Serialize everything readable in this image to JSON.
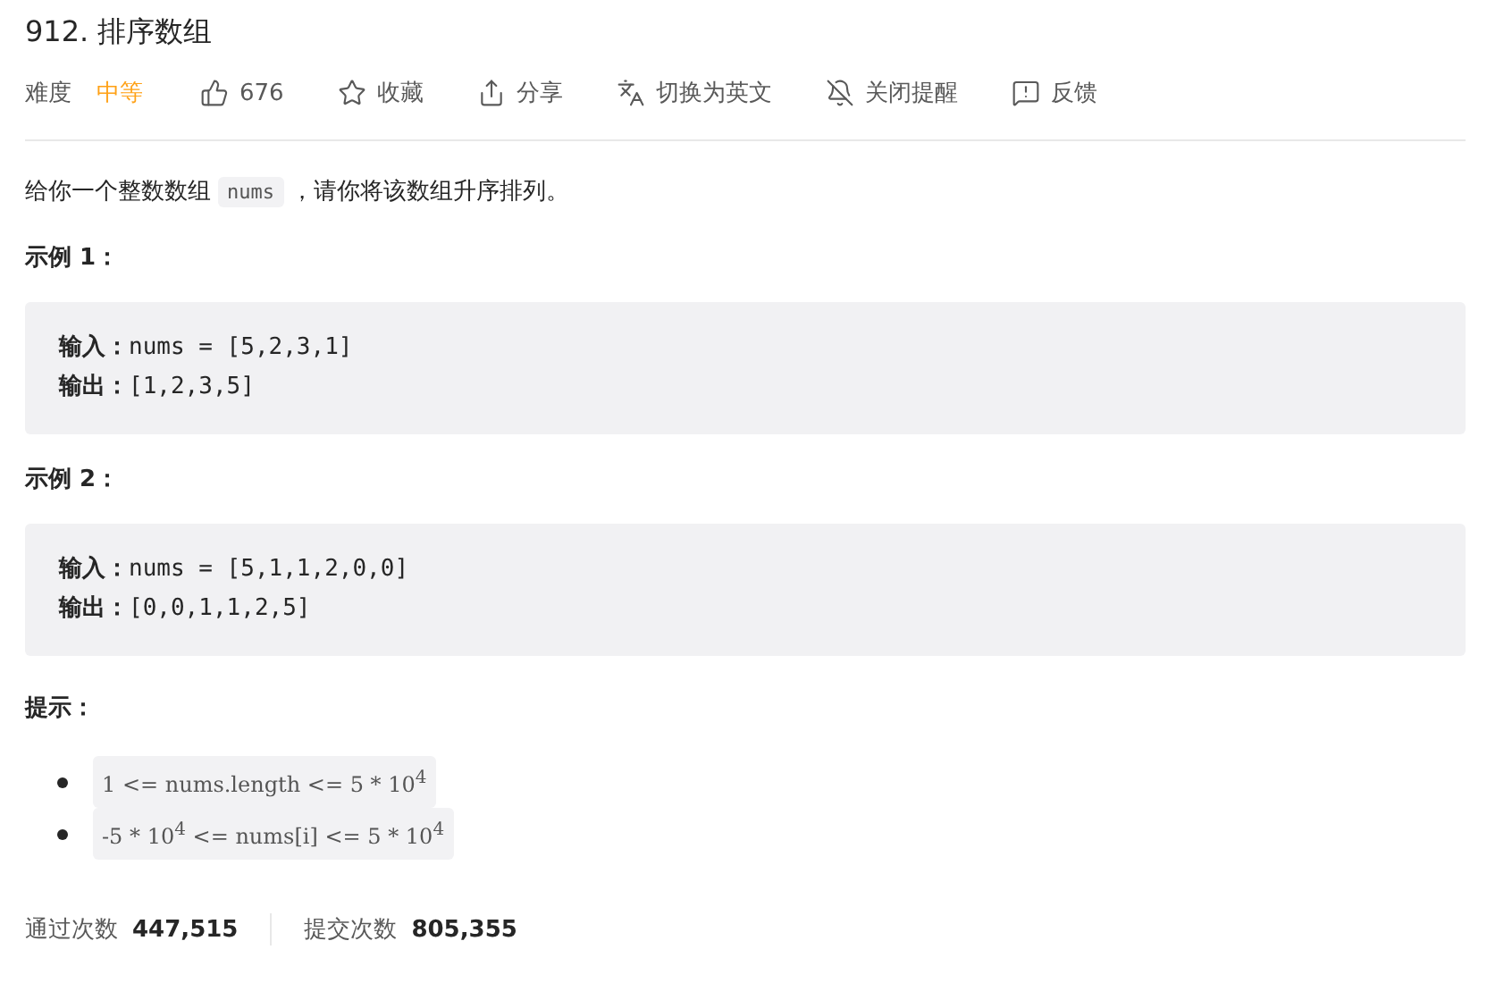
{
  "title": "912. 排序数组",
  "meta": {
    "difficulty_label": "难度",
    "difficulty": "中等"
  },
  "actions": [
    {
      "kind": "like",
      "label": "676"
    },
    {
      "kind": "star",
      "label": "收藏"
    },
    {
      "kind": "share",
      "label": "分享"
    },
    {
      "kind": "translate",
      "label": "切换为英文"
    },
    {
      "kind": "bell",
      "label": "关闭提醒"
    },
    {
      "kind": "feedback",
      "label": "反馈"
    }
  ],
  "description": [
    {
      "kind": "text",
      "text": "给你一个整数数组"
    },
    {
      "kind": "code",
      "text": "nums"
    },
    {
      "kind": "text",
      "text": "，请你将该数组升序排列。"
    }
  ],
  "examples": [
    {
      "heading": "示例 1：",
      "lines": [
        {
          "label": "输入：",
          "value": "nums = [5,2,3,1]"
        },
        {
          "label": "输出：",
          "value": "[1,2,3,5]"
        }
      ]
    },
    {
      "heading": "示例 2：",
      "lines": [
        {
          "label": "输入：",
          "value": "nums = [5,1,1,2,0,0]"
        },
        {
          "label": "输出：",
          "value": "[0,0,1,1,2,5]"
        }
      ]
    }
  ],
  "hints_heading": "提示：",
  "hints": [
    "1 <= nums.length <= 5 * 10$^{4}$",
    "-5 * 10$^{4}$ <= nums[i] <= 5 * 10$^{4}$"
  ],
  "stats": [
    {
      "label": "通过次数",
      "value": "447,515"
    },
    {
      "label": "提交次数",
      "value": "805,355"
    }
  ]
}
